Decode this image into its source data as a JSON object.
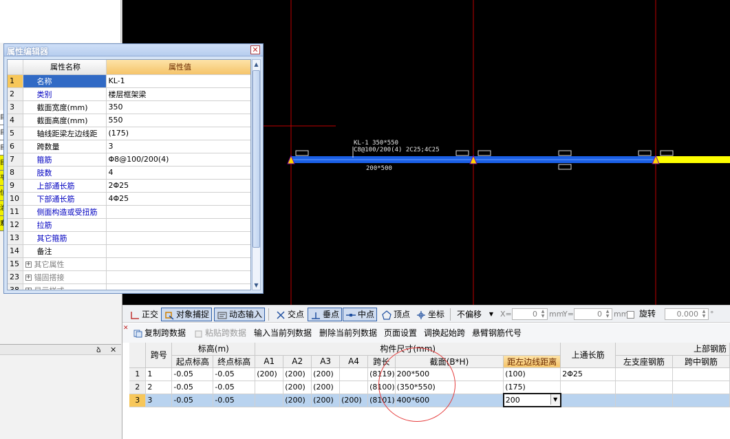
{
  "left_pane": {
    "strip_chars": [
      "目",
      "目",
      "目",
      "目",
      "平",
      "位",
      "治",
      "素"
    ],
    "lower_header_pin": "ձ",
    "lower_header_close": "✕"
  },
  "property_editor": {
    "title": "属性编辑器",
    "close_label": "✕",
    "col_name": "属性名称",
    "col_value": "属性值",
    "rows": [
      {
        "num": "1",
        "name": "名称",
        "value": "KL-1",
        "style": "blue",
        "selected": true
      },
      {
        "num": "2",
        "name": "类别",
        "value": "楼层框架梁",
        "style": "blue"
      },
      {
        "num": "3",
        "name": "截面宽度(mm)",
        "value": "350",
        "style": "black"
      },
      {
        "num": "4",
        "name": "截面高度(mm)",
        "value": "550",
        "style": "black"
      },
      {
        "num": "5",
        "name": "轴线距梁左边线距",
        "value": "(175)",
        "style": "black"
      },
      {
        "num": "6",
        "name": "跨数量",
        "value": "3",
        "style": "black"
      },
      {
        "num": "7",
        "name": "箍筋",
        "value": "Φ8@100/200(4)",
        "style": "blue"
      },
      {
        "num": "8",
        "name": "肢数",
        "value": "4",
        "style": "blue"
      },
      {
        "num": "9",
        "name": "上部通长筋",
        "value": "2Φ25",
        "style": "blue"
      },
      {
        "num": "10",
        "name": "下部通长筋",
        "value": "4Φ25",
        "style": "blue"
      },
      {
        "num": "11",
        "name": "侧面构造或受扭筋",
        "value": "",
        "style": "blue"
      },
      {
        "num": "12",
        "name": "拉筋",
        "value": "",
        "style": "blue"
      },
      {
        "num": "13",
        "name": "其它箍筋",
        "value": "",
        "style": "blue"
      },
      {
        "num": "14",
        "name": "备注",
        "value": "",
        "style": "black"
      },
      {
        "num": "15",
        "name": "其它属性",
        "value": "",
        "style": "gray",
        "group": true
      },
      {
        "num": "23",
        "name": "锚固搭接",
        "value": "",
        "style": "gray",
        "group": true
      },
      {
        "num": "38",
        "name": "显示样式",
        "value": "",
        "style": "gray",
        "group": true
      }
    ]
  },
  "cad": {
    "annotation_line1": "KL-1 350*550",
    "annotation_line2": "C8@100/200(4) 2C25;4C25",
    "section_label": "200*500",
    "colors": {
      "beam": "#1a5fe6",
      "beam_end": "#ffff00",
      "axis": "#c00000",
      "marker": "#ffd700"
    }
  },
  "toolbar": {
    "ortho": "正交",
    "snap": "对象捕捉",
    "dyn_input": "动态输入",
    "intersect": "交点",
    "perpendicular": "垂点",
    "midpoint": "中点",
    "vertex": "顶点",
    "coordinate": "坐标",
    "offset_mode": "不偏移",
    "x_label": "X=",
    "x_value": "0",
    "unit1": "mm",
    "y_label": "Y=",
    "y_value": "0",
    "unit2": "mm",
    "rotate_label": "旋转",
    "rotate_value": "0.000",
    "deg": "°"
  },
  "commands": {
    "copy_span": "复制跨数据",
    "paste_span": "粘贴跨数据",
    "input_col": "输入当前列数据",
    "delete_col": "删除当前列数据",
    "page_setup": "页面设置",
    "swap_start": "调换起始跨",
    "cantilever": "悬臂钢筋代号"
  },
  "span_table": {
    "h_span_no": "跨号",
    "h_elevation": "标高(m)",
    "h_start_elev": "起点标高",
    "h_end_elev": "终点标高",
    "h_size": "构件尺寸(mm)",
    "h_a1": "A1",
    "h_a2": "A2",
    "h_a3": "A3",
    "h_a4": "A4",
    "h_length": "跨长",
    "h_section": "截面(B*H)",
    "h_left_dist": "距左边线距离",
    "h_top_long": "上通长筋",
    "h_top_rebar": "上部钢筋",
    "h_left_support": "左支座钢筋",
    "h_mid_span": "跨中钢筋",
    "rows": [
      {
        "rn": "1",
        "span": "1",
        "start": "-0.05",
        "end": "-0.05",
        "a1": "(200)",
        "a2": "(200)",
        "a3": "(200)",
        "a4": "",
        "len": "(8119)",
        "sec": "200*500",
        "dist": "(100)",
        "top": "2Φ25",
        "ls": "",
        "mid": ""
      },
      {
        "rn": "2",
        "span": "2",
        "start": "-0.05",
        "end": "-0.05",
        "a1": "",
        "a2": "(200)",
        "a3": "(200)",
        "a4": "",
        "len": "(8100)",
        "sec": "(350*550)",
        "dist": "(175)",
        "top": "",
        "ls": "",
        "mid": ""
      },
      {
        "rn": "3",
        "span": "3",
        "start": "-0.05",
        "end": "-0.05",
        "a1": "",
        "a2": "(200)",
        "a3": "(200)",
        "a4": "(200)",
        "len": "(8101)",
        "sec": "400*600",
        "dist": "200",
        "top": "",
        "ls": "",
        "mid": ""
      }
    ]
  }
}
